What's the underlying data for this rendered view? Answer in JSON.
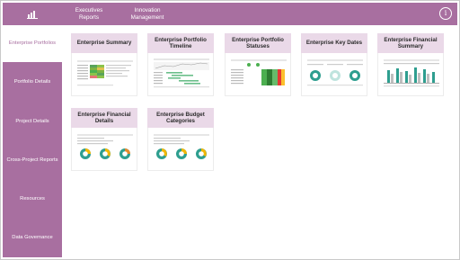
{
  "topbar": {
    "home_icon": "bar-chart-icon",
    "tabs": [
      {
        "label": "Executives Reports"
      },
      {
        "label": "Innovation Management"
      }
    ],
    "info_icon": "info-icon",
    "info_label": "i"
  },
  "sidebar": {
    "items": [
      {
        "label": "Enterprise Portfolios",
        "active": true
      },
      {
        "label": "Portfolio Details",
        "active": false
      },
      {
        "label": "Project Details",
        "active": false
      },
      {
        "label": "Cross-Project Reports",
        "active": false
      },
      {
        "label": "Resources",
        "active": false
      },
      {
        "label": "Data Governance",
        "active": false
      }
    ]
  },
  "reports": [
    {
      "title": "Enterprise Summary",
      "thumbnail": "summary-table-heatmap"
    },
    {
      "title": "Enterprise Portfolio Timeline",
      "thumbnail": "timeline-gantt"
    },
    {
      "title": "Enterprise Portfolio Statuses",
      "thumbnail": "status-table"
    },
    {
      "title": "Enterprise Key Dates",
      "thumbnail": "donut-charts"
    },
    {
      "title": "Enterprise Financial Summary",
      "thumbnail": "bar-chart"
    },
    {
      "title": "Enterprise Financial Details",
      "thumbnail": "donut-charts"
    },
    {
      "title": "Enterprise Budget Categories",
      "thumbnail": "donut-charts"
    }
  ],
  "colors": {
    "accent": "#a86fa0",
    "card_header": "#ead9e8",
    "active_text": "#a86fa0"
  }
}
